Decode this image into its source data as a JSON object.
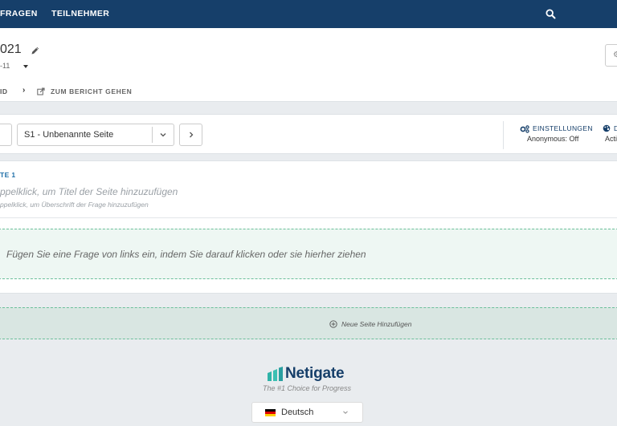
{
  "nav": {
    "items": [
      "FRAGEN",
      "TEILNEHMER"
    ]
  },
  "header": {
    "title": "021",
    "subinfo": "-11",
    "breadcrumb": {
      "item1": "ID",
      "separator": "›",
      "item2": "ZUM BERICHT GEHEN"
    }
  },
  "toolbar": {
    "page_select_value": "S1 - Unbenannte Seite",
    "settings_label": "EINSTELLUNGEN",
    "anonymous_label": "Anonymous: Off",
    "design_label": "D",
    "design_sub": "Acti"
  },
  "page": {
    "label": "TE 1",
    "title_placeholder": "ppelklick, um Titel der Seite hinzuzufügen",
    "heading_placeholder": "ppelklick, um Überschrift der Frage hinzuzufügen",
    "dropzone_text": "Fügen Sie eine Frage von links ein, indem Sie darauf klicken oder sie hierher ziehen"
  },
  "add_page": {
    "label": "Neue Seite Hinzufügen"
  },
  "footer": {
    "brand": "Netigate",
    "tagline": "The #1 Choice for Progress",
    "language": "Deutsch"
  },
  "colors": {
    "nav_bg": "#163f6a",
    "accent_blue": "#1f6fa8",
    "dropzone_border": "#6bbf9a",
    "logo_teal": "#2fb3a8"
  }
}
